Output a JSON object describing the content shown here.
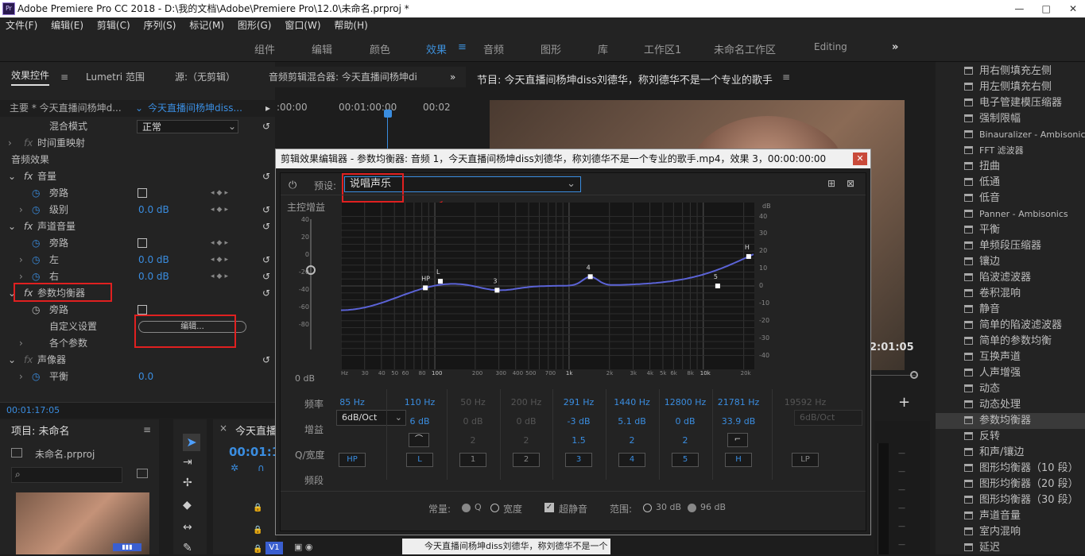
{
  "window": {
    "title": "Adobe Premiere Pro CC 2018 - D:\\我的文档\\Adobe\\Premiere Pro\\12.0\\未命名.prproj *",
    "controls": [
      "—",
      "□",
      "✕"
    ]
  },
  "menu": [
    "文件(F)",
    "编辑(E)",
    "剪辑(C)",
    "序列(S)",
    "标记(M)",
    "图形(G)",
    "窗口(W)",
    "帮助(H)"
  ],
  "workspaces": [
    "组件",
    "编辑",
    "颜色",
    "效果",
    "音频",
    "图形",
    "库",
    "工作区1",
    "未命名工作区",
    "Editing",
    "»"
  ],
  "effect_controls": {
    "tabs": [
      "效果控件",
      "Lumetri 范围",
      "源:（无剪辑）",
      "音频剪辑混合器: 今天直播间杨坤di",
      "»"
    ],
    "master": "主要 * 今天直播间杨坤d...",
    "clip": "今天直播间杨坤diss...",
    "ruler": [
      ":00:00",
      "00:01:00:00",
      "00:02"
    ],
    "blend_label": "混合模式",
    "blend_value": "正常",
    "time_remap": "时间重映射",
    "audio_fx": "音频效果",
    "volume": "音量",
    "bypass": "旁路",
    "level": "级别",
    "level_val": "0.0 dB",
    "channel_vol": "声道音量",
    "left": "左",
    "left_val": "0.0 dB",
    "right": "右",
    "right_val": "0.0 dB",
    "param_eq": "参数均衡器",
    "custom_setup": "自定义设置",
    "edit_btn": "编辑...",
    "params": "各个参数",
    "panner": "声像器",
    "balance": "平衡",
    "balance_val": "0.0",
    "timecode": "00:01:17:05",
    "fx": "fx"
  },
  "program": {
    "title": "节目: 今天直播间杨坤diss刘德华，称刘德华不是一个专业的歌手",
    "time": "2:01:05",
    "plus": "+"
  },
  "effects_list": [
    "用右侧填充左侧",
    "用左侧填充右侧",
    "电子管建模压缩器",
    "强制限幅",
    "Binauralizer - Ambisonics",
    "FFT 滤波器",
    "扭曲",
    "低通",
    "低音",
    "Panner - Ambisonics",
    "平衡",
    "单频段压缩器",
    "镶边",
    "陷波滤波器",
    "卷积混响",
    "静音",
    "简单的陷波滤波器",
    "简单的参数均衡",
    "互换声道",
    "人声增强",
    "动态",
    "动态处理",
    "参数均衡器",
    "反转",
    "和声/镶边",
    "图形均衡器（10 段）",
    "图形均衡器（20 段）",
    "图形均衡器（30 段）",
    "声道音量",
    "室内混响",
    "延迟"
  ],
  "effects_selected_index": 22,
  "project": {
    "title": "项目: 未命名",
    "file": "未命名.prproj"
  },
  "timeline": {
    "tab": "今天直播",
    "time": "00:01:1",
    "track": "V1"
  },
  "caption_strip": "今天直播间杨坤diss刘德华，称刘德华不是一个",
  "dialog": {
    "title": "剪辑效果编辑器 - 参数均衡器: 音频 1，今天直播间杨坤diss刘德华，称刘德华不是一个专业的歌手.mp4，效果 3，00:00:00:00",
    "close": "✕",
    "preset_label": "预设:",
    "preset_value": "说唱声乐",
    "master_gain": "主控增益",
    "master_db": "0 dB",
    "gain_scale_left": [
      "40",
      "20",
      "0",
      "-20",
      "-40",
      "-60",
      "-80"
    ],
    "db_unit": "dB",
    "db_scale_right": [
      "40",
      "30",
      "20",
      "10",
      "0",
      "-10",
      "-20",
      "-30",
      "-40"
    ],
    "freq_ticks": [
      "Hz",
      "30",
      "40",
      "50",
      "60",
      "80",
      "100",
      "200",
      "300",
      "400",
      "500",
      "700",
      "1k",
      "2k",
      "3k",
      "4k",
      "5k",
      "6k",
      "8k",
      "10k",
      "20k"
    ],
    "freq_label": "频率",
    "gain_label": "增益",
    "q_label": "Q/宽度",
    "band_label": "频段",
    "slope": "6dB/Oct",
    "slope_dim": "6dB/Oct",
    "bands": [
      {
        "id": "HP",
        "freq": "85 Hz",
        "gain": "",
        "q": "",
        "on": true
      },
      {
        "id": "L",
        "freq": "110 Hz",
        "gain": "6 dB",
        "q": "",
        "on": true
      },
      {
        "id": "1",
        "freq": "50 Hz",
        "gain": "0 dB",
        "q": "2",
        "on": false
      },
      {
        "id": "2",
        "freq": "200 Hz",
        "gain": "0 dB",
        "q": "2",
        "on": false
      },
      {
        "id": "3",
        "freq": "291 Hz",
        "gain": "-3 dB",
        "q": "1.5",
        "on": true
      },
      {
        "id": "4",
        "freq": "1440 Hz",
        "gain": "5.1 dB",
        "q": "2",
        "on": true
      },
      {
        "id": "5",
        "freq": "12800 Hz",
        "gain": "0 dB",
        "q": "2",
        "on": true
      },
      {
        "id": "H",
        "freq": "21781 Hz",
        "gain": "33.9 dB",
        "q": "",
        "on": true
      },
      {
        "id": "LP",
        "freq": "19592 Hz",
        "gain": "",
        "q": "",
        "on": false
      }
    ],
    "constant_label": "常量:",
    "q_opt": "Q",
    "width_opt": "宽度",
    "ultra_quiet": "超静音",
    "range_label": "范围:",
    "range_30": "30 dB",
    "range_96": "96 dB",
    "eq_points": [
      {
        "label": "HP",
        "freq": 85,
        "gain": 0
      },
      {
        "label": "L",
        "freq": 110,
        "gain": 6
      },
      {
        "label": "3",
        "freq": 291,
        "gain": -3
      },
      {
        "label": "4",
        "freq": 1440,
        "gain": 5.1
      },
      {
        "label": "5",
        "freq": 12800,
        "gain": 0
      },
      {
        "label": "H",
        "freq": 21781,
        "gain": 33.9
      }
    ]
  }
}
